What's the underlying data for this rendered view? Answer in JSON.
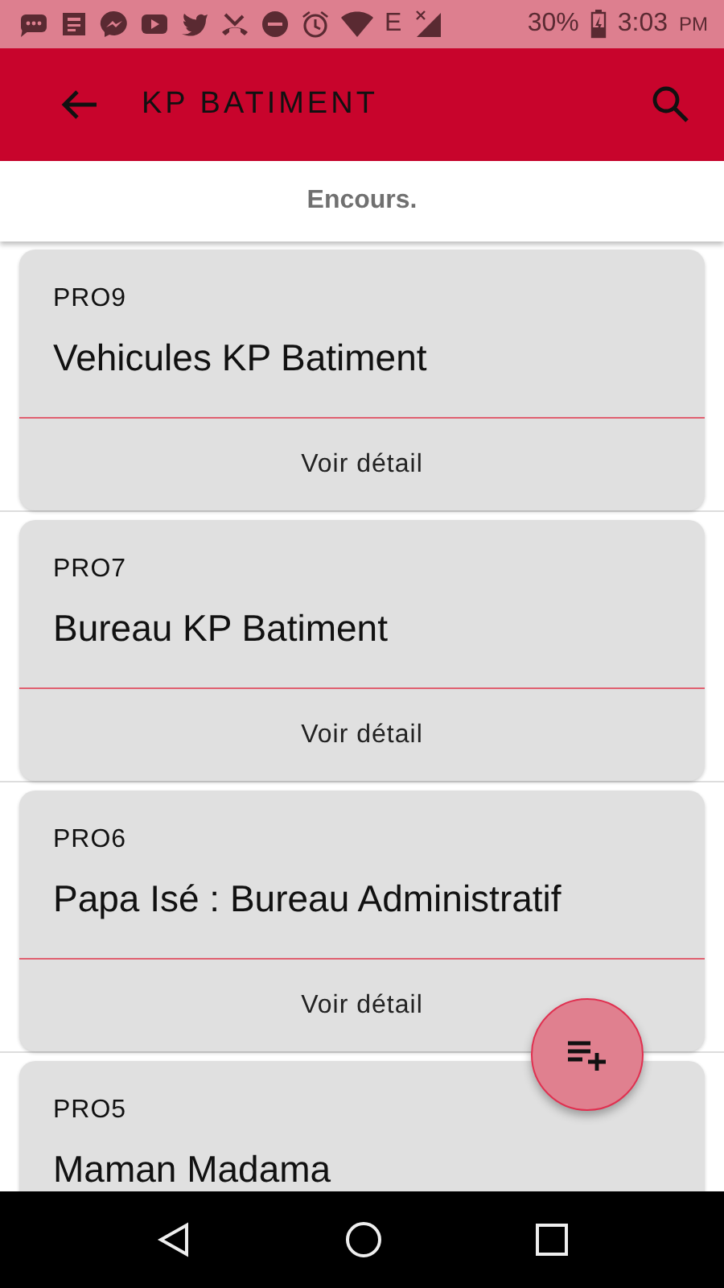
{
  "status_bar": {
    "network": "E",
    "battery": "30%",
    "time": "3:03",
    "time_suffix": "PM"
  },
  "header": {
    "title": "KP BATIMENT"
  },
  "tab": {
    "label": "Encours."
  },
  "projects": [
    {
      "code": "PRO9",
      "name": "Vehicules KP Batiment",
      "action": "Voir détail"
    },
    {
      "code": "PRO7",
      "name": "Bureau KP Batiment",
      "action": "Voir détail"
    },
    {
      "code": "PRO6",
      "name": "Papa Isé : Bureau Administratif",
      "action": "Voir détail"
    },
    {
      "code": "PRO5",
      "name": "Maman Madama"
    }
  ]
}
